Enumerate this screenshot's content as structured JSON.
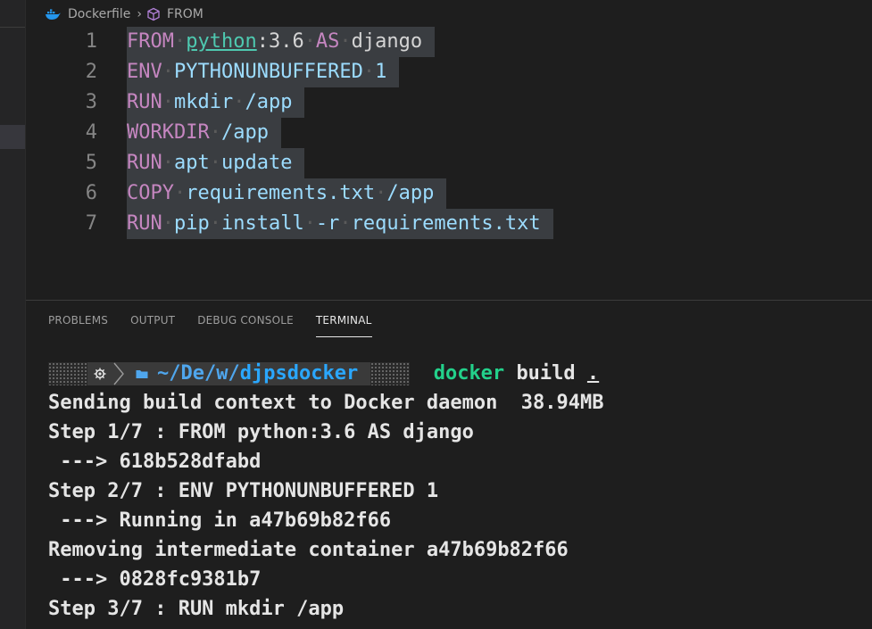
{
  "breadcrumb": {
    "file": "Dockerfile",
    "symbol": "FROM"
  },
  "editor": {
    "lines": [
      {
        "no": "1",
        "tokens": [
          {
            "t": "FROM",
            "c": "kw"
          },
          {
            "t": " ",
            "c": "ws"
          },
          {
            "t": "python",
            "c": "link"
          },
          {
            "t": ":3.6",
            "c": "plain"
          },
          {
            "t": " ",
            "c": "ws"
          },
          {
            "t": "AS",
            "c": "kw"
          },
          {
            "t": " ",
            "c": "ws"
          },
          {
            "t": "django",
            "c": "plain"
          }
        ]
      },
      {
        "no": "2",
        "tokens": [
          {
            "t": "ENV",
            "c": "kw"
          },
          {
            "t": " ",
            "c": "ws"
          },
          {
            "t": "PYTHONUNBUFFERED",
            "c": "ident"
          },
          {
            "t": " ",
            "c": "ws"
          },
          {
            "t": "1",
            "c": "ident"
          }
        ]
      },
      {
        "no": "3",
        "tokens": [
          {
            "t": "RUN",
            "c": "kw"
          },
          {
            "t": " ",
            "c": "ws"
          },
          {
            "t": "mkdir",
            "c": "ident"
          },
          {
            "t": " ",
            "c": "ws"
          },
          {
            "t": "/app",
            "c": "ident"
          }
        ]
      },
      {
        "no": "4",
        "tokens": [
          {
            "t": "WORKDIR",
            "c": "kw"
          },
          {
            "t": " ",
            "c": "ws"
          },
          {
            "t": "/app",
            "c": "ident"
          }
        ]
      },
      {
        "no": "5",
        "tokens": [
          {
            "t": "RUN",
            "c": "kw"
          },
          {
            "t": " ",
            "c": "ws"
          },
          {
            "t": "apt",
            "c": "ident"
          },
          {
            "t": " ",
            "c": "ws"
          },
          {
            "t": "update",
            "c": "ident"
          }
        ]
      },
      {
        "no": "6",
        "tokens": [
          {
            "t": "COPY",
            "c": "kw"
          },
          {
            "t": " ",
            "c": "ws"
          },
          {
            "t": "requirements.txt",
            "c": "ident"
          },
          {
            "t": " ",
            "c": "ws"
          },
          {
            "t": "/app",
            "c": "ident"
          }
        ]
      },
      {
        "no": "7",
        "tokens": [
          {
            "t": "RUN",
            "c": "kw"
          },
          {
            "t": " ",
            "c": "ws"
          },
          {
            "t": "pip",
            "c": "ident"
          },
          {
            "t": " ",
            "c": "ws"
          },
          {
            "t": "install",
            "c": "ident"
          },
          {
            "t": " ",
            "c": "ws"
          },
          {
            "t": "-r",
            "c": "ident"
          },
          {
            "t": " ",
            "c": "ws"
          },
          {
            "t": "requirements.txt",
            "c": "ident"
          }
        ]
      }
    ]
  },
  "panel": {
    "tabs": [
      "PROBLEMS",
      "OUTPUT",
      "DEBUG CONSOLE",
      "TERMINAL"
    ],
    "active_tab": "TERMINAL"
  },
  "terminal": {
    "prompt": {
      "tilde": "~",
      "segments": [
        "/De",
        "/w",
        "/"
      ],
      "last": "djpsdocker",
      "command": "docker",
      "args": "build",
      "dot": "."
    },
    "output": [
      "Sending build context to Docker daemon  38.94MB",
      "Step 1/7 : FROM python:3.6 AS django",
      " ---> 618b528dfabd",
      "Step 2/7 : ENV PYTHONUNBUFFERED 1",
      " ---> Running in a47b69b82f66",
      "Removing intermediate container a47b69b82f66",
      " ---> 0828fc9381b7",
      "Step 3/7 : RUN mkdir /app"
    ]
  },
  "colors": {
    "background": "#1e1e1e",
    "keyword": "#c586c0",
    "identifier": "#9cdcfe",
    "link": "#4ec9b0",
    "line_highlight": "#3a3d41",
    "command_green": "#23d18b",
    "path_blue": "#4fa6ed"
  },
  "icons": {
    "file_icon": "docker-whale-icon",
    "symbol_icon": "cube-icon",
    "prompt_os_icon": "gear-icon",
    "prompt_folder_icon": "folder-icon"
  }
}
